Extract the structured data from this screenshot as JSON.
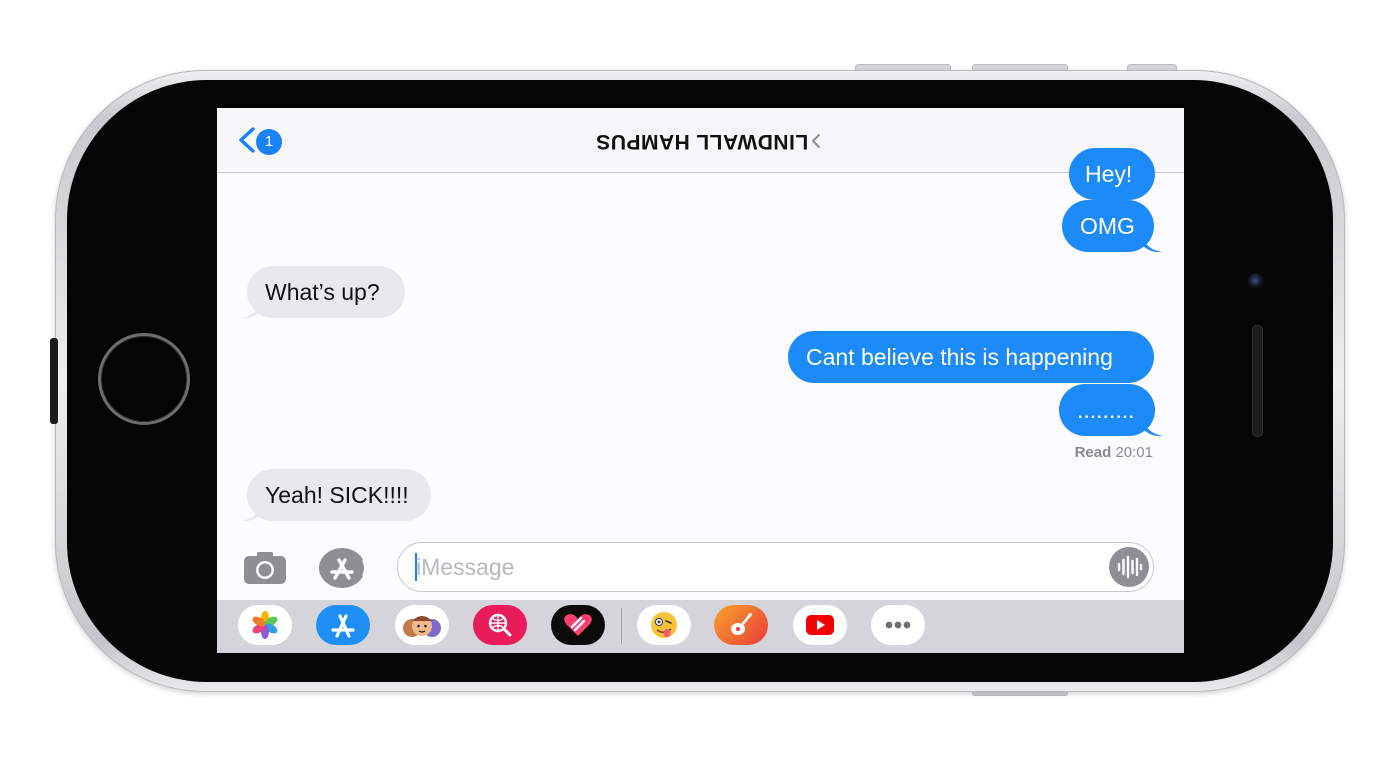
{
  "device": {
    "model": "iPhone",
    "orientation": "landscape"
  },
  "navbar": {
    "back_badge_count": "1",
    "contact_name": "LINDWALL HAMPUS"
  },
  "conversation": {
    "messages": [
      {
        "id": "m1",
        "direction": "sent",
        "text": "Hey!"
      },
      {
        "id": "m2",
        "direction": "sent",
        "text": "OMG"
      },
      {
        "id": "m3",
        "direction": "received",
        "text": "What’s up?"
      },
      {
        "id": "m4",
        "direction": "sent",
        "text": "Cant believe this is happening"
      },
      {
        "id": "m5",
        "direction": "sent",
        "text": "........."
      },
      {
        "id": "m6",
        "direction": "received",
        "text": "Yeah! SICK!!!!"
      }
    ],
    "read_receipt": {
      "label": "Read",
      "time": "20:01"
    }
  },
  "composer": {
    "placeholder": "iMessage",
    "value": "",
    "camera_icon": "camera-icon",
    "apps_icon": "app-store-icon",
    "audio_icon": "audio-waveform-icon"
  },
  "app_drawer": {
    "apps": [
      {
        "name": "photos-app-icon"
      },
      {
        "name": "app-store-app-icon"
      },
      {
        "name": "memoji-stickers-app-icon"
      },
      {
        "name": "images-search-app-icon"
      },
      {
        "name": "digital-touch-app-icon"
      },
      {
        "name": "animoji-app-icon"
      },
      {
        "name": "garageband-app-icon"
      },
      {
        "name": "youtube-app-icon"
      },
      {
        "name": "more-apps-icon"
      }
    ]
  },
  "colors": {
    "sent_bubble": "#1c8af8",
    "received_bubble": "#e9e8ed",
    "accent": "#1a82fb",
    "drawer_background": "#d5d4da"
  }
}
